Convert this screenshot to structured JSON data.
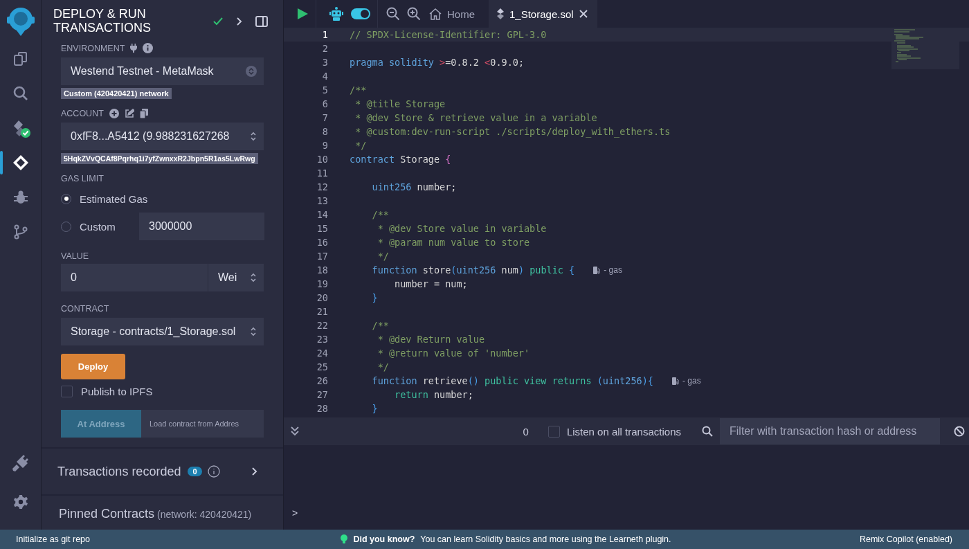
{
  "icon_bar": {
    "items": [
      {
        "kind": "logo",
        "selected": false
      },
      {
        "kind": "files",
        "selected": false
      },
      {
        "kind": "search",
        "selected": false
      },
      {
        "kind": "compiler",
        "selected": false
      },
      {
        "kind": "deploy",
        "selected": true
      },
      {
        "kind": "debugger",
        "selected": false
      },
      {
        "kind": "git",
        "selected": false
      }
    ],
    "bottom_items": [
      {
        "kind": "plugin",
        "selected": false
      },
      {
        "kind": "settings",
        "selected": false
      }
    ]
  },
  "panel": {
    "title_lines": [
      "DEPLOY & RUN",
      "TRANSACTIONS"
    ],
    "environment": {
      "label": "ENVIRONMENT",
      "value": "Westend Testnet - MetaMask",
      "badge": "Custom (420420421) network"
    },
    "account": {
      "label": "ACCOUNT",
      "value": "0xfF8...A5412 (9.988231627268",
      "badge": "5HqkZVvQCAf8Pqrhq1i7yfZwnxxR2Jbpn5R1as5LwRwg"
    },
    "gas_limit": {
      "label": "GAS LIMIT",
      "options": [
        {
          "label": "Estimated Gas",
          "selected": true
        },
        {
          "label": "Custom",
          "selected": false,
          "value": "3000000"
        }
      ]
    },
    "value": {
      "label": "VALUE",
      "amount": "0",
      "unit": "Wei"
    },
    "contract": {
      "label": "CONTRACT",
      "value": "Storage - contracts/1_Storage.sol"
    },
    "deploy_button": "Deploy",
    "publish_ipfs": {
      "label": "Publish to IPFS",
      "checked": false
    },
    "at_address": {
      "button": "At Address",
      "placeholder": "Load contract from Addres"
    },
    "transactions_recorded": {
      "label": "Transactions recorded",
      "count": "0"
    },
    "pinned_contracts": {
      "label": "Pinned Contracts",
      "network": "(network: 420420421)"
    }
  },
  "toolbar": {
    "autocompile_on": true,
    "tabs": [
      {
        "label": "Home",
        "kind": "home",
        "selected": false
      },
      {
        "label": "1_Storage.sol",
        "kind": "file",
        "selected": true
      }
    ]
  },
  "editor": {
    "lines": [
      {
        "number": "1",
        "current": true,
        "tokens": [
          {
            "kind": "comment",
            "text": "// SPDX-License-Identifier: GPL-3.0"
          }
        ]
      },
      {
        "number": "2",
        "current": false
      },
      {
        "number": "3",
        "current": false,
        "tokens": [
          {
            "kind": "keyword",
            "text": "pragma"
          },
          {
            "kind": "keyword",
            "text": " solidity"
          },
          {
            "kind": "operator",
            "text": " >"
          },
          {
            "kind": "plain",
            "text": "=0.8.2"
          },
          {
            "kind": "operator",
            "text": " <"
          },
          {
            "kind": "plain",
            "text": "0.9.0;"
          }
        ]
      },
      {
        "number": "4",
        "current": false
      },
      {
        "number": "5",
        "current": false,
        "tokens": [
          {
            "kind": "comment",
            "text": "/**"
          }
        ]
      },
      {
        "number": "6",
        "current": false,
        "tokens": [
          {
            "kind": "comment",
            "text": " * @title Storage"
          }
        ]
      },
      {
        "number": "7",
        "current": false,
        "tokens": [
          {
            "kind": "comment",
            "text": " * @dev Store & retrieve value in a variable"
          }
        ]
      },
      {
        "number": "8",
        "current": false,
        "tokens": [
          {
            "kind": "comment",
            "text": " * @custom:dev-run-script ./scripts/deploy_with_ethers.ts"
          }
        ]
      },
      {
        "number": "9",
        "current": false,
        "tokens": [
          {
            "kind": "comment",
            "text": " */"
          }
        ]
      },
      {
        "number": "10",
        "current": false,
        "tokens": [
          {
            "kind": "keyword",
            "text": "contract"
          },
          {
            "kind": "plain",
            "text": " Storage"
          },
          {
            "kind": "brace",
            "text": " {"
          }
        ]
      },
      {
        "number": "11",
        "current": false
      },
      {
        "number": "12",
        "current": false,
        "tokens": [
          {
            "kind": "type",
            "text": "    uint256"
          },
          {
            "kind": "plain",
            "text": " number;"
          }
        ]
      },
      {
        "number": "13",
        "current": false
      },
      {
        "number": "14",
        "current": false,
        "tokens": [
          {
            "kind": "comment",
            "text": "    /**"
          }
        ]
      },
      {
        "number": "15",
        "current": false,
        "tokens": [
          {
            "kind": "comment",
            "text": "     * @dev Store value in variable"
          }
        ]
      },
      {
        "number": "16",
        "current": false,
        "tokens": [
          {
            "kind": "comment",
            "text": "     * @param num value to store"
          }
        ]
      },
      {
        "number": "17",
        "current": false,
        "tokens": [
          {
            "kind": "comment",
            "text": "     */"
          }
        ]
      },
      {
        "number": "18",
        "current": false,
        "gas_hint": "- gas",
        "tokens": [
          {
            "kind": "keyword",
            "text": "    function"
          },
          {
            "kind": "plain",
            "text": " store"
          },
          {
            "kind": "paren",
            "text": "("
          },
          {
            "kind": "type",
            "text": "uint256"
          },
          {
            "kind": "plain",
            "text": " num"
          },
          {
            "kind": "paren",
            "text": ")"
          },
          {
            "kind": "modifier",
            "text": " public"
          },
          {
            "kind": "paren",
            "text": " {"
          }
        ]
      },
      {
        "number": "19",
        "current": false,
        "tokens": [
          {
            "kind": "plain",
            "text": "        number = num;"
          }
        ]
      },
      {
        "number": "20",
        "current": false,
        "tokens": [
          {
            "kind": "paren",
            "text": "    }"
          }
        ]
      },
      {
        "number": "21",
        "current": false
      },
      {
        "number": "22",
        "current": false,
        "tokens": [
          {
            "kind": "comment",
            "text": "    /**"
          }
        ]
      },
      {
        "number": "23",
        "current": false,
        "tokens": [
          {
            "kind": "comment",
            "text": "     * @dev Return value"
          }
        ]
      },
      {
        "number": "24",
        "current": false,
        "tokens": [
          {
            "kind": "comment",
            "text": "     * @return value of 'number'"
          }
        ]
      },
      {
        "number": "25",
        "current": false,
        "tokens": [
          {
            "kind": "comment",
            "text": "     */"
          }
        ]
      },
      {
        "number": "26",
        "current": false,
        "gas_hint": "- gas",
        "tokens": [
          {
            "kind": "keyword",
            "text": "    function"
          },
          {
            "kind": "plain",
            "text": " retrieve"
          },
          {
            "kind": "paren",
            "text": "()"
          },
          {
            "kind": "modifier",
            "text": " public view returns"
          },
          {
            "kind": "paren",
            "text": " ("
          },
          {
            "kind": "type",
            "text": "uint256"
          },
          {
            "kind": "paren",
            "text": "){"
          }
        ]
      },
      {
        "number": "27",
        "current": false,
        "tokens": [
          {
            "kind": "modifier",
            "text": "        return"
          },
          {
            "kind": "plain",
            "text": " number;"
          }
        ]
      },
      {
        "number": "28",
        "current": false,
        "tokens": [
          {
            "kind": "paren",
            "text": "    }"
          }
        ]
      }
    ]
  },
  "terminal": {
    "count": "0",
    "listen_all": {
      "label": "Listen on all transactions",
      "checked": false
    },
    "filter_placeholder": "Filter with transaction hash or address",
    "prompt": ">"
  },
  "status_bar": {
    "left": "Initialize as git repo",
    "tip_title": "Did you know?",
    "tip": "You can learn Solidity basics and more using the Learneth plugin.",
    "right": "Remix Copilot (enabled)"
  }
}
